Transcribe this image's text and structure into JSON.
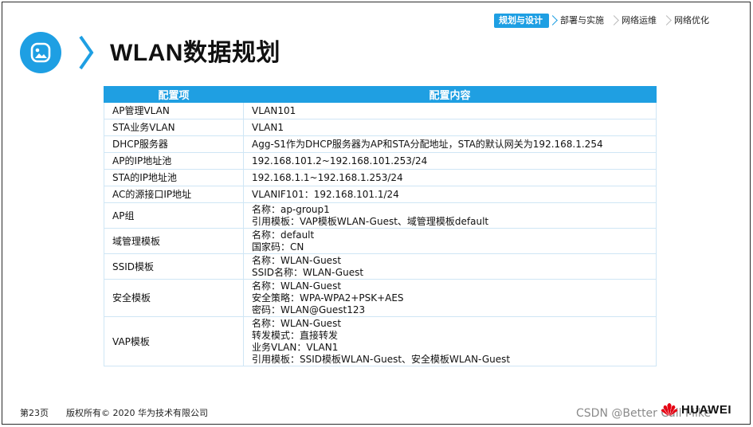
{
  "breadcrumb": {
    "items": [
      "规划与设计",
      "部署与实施",
      "网络运维",
      "网络优化"
    ],
    "active_index": 0
  },
  "header": {
    "title": "WLAN数据规划",
    "logo_icon": "image-icon"
  },
  "table": {
    "headers": [
      "配置项",
      "配置内容"
    ],
    "rows": [
      {
        "key": "AP管理VLAN",
        "lines": [
          "VLAN101"
        ]
      },
      {
        "key": "STA业务VLAN",
        "lines": [
          "VLAN1"
        ]
      },
      {
        "key": "DHCP服务器",
        "lines": [
          "Agg-S1作为DHCP服务器为AP和STA分配地址，STA的默认网关为192.168.1.254"
        ]
      },
      {
        "key": "AP的IP地址池",
        "lines": [
          "192.168.101.2~192.168.101.253/24"
        ]
      },
      {
        "key": "STA的IP地址池",
        "lines": [
          "192.168.1.1~192.168.1.253/24"
        ]
      },
      {
        "key": "AC的源接口IP地址",
        "lines": [
          "VLANIF101：192.168.101.1/24"
        ]
      },
      {
        "key": "AP组",
        "lines": [
          "名称：ap-group1",
          "引用模板：VAP模板WLAN-Guest、域管理模板default"
        ]
      },
      {
        "key": "域管理模板",
        "lines": [
          "名称：default",
          "国家码：CN"
        ]
      },
      {
        "key": "SSID模板",
        "lines": [
          "名称：WLAN-Guest",
          "SSID名称：WLAN-Guest"
        ]
      },
      {
        "key": "安全模板",
        "lines": [
          "名称：WLAN-Guest",
          "安全策略：WPA-WPA2+PSK+AES",
          "密码：WLAN@Guest123"
        ]
      },
      {
        "key": "VAP模板",
        "lines": [
          "名称：WLAN-Guest",
          "转发模式：直接转发",
          "业务VLAN：VLAN1",
          "引用模板：SSID模板WLAN-Guest、安全模板WLAN-Guest"
        ]
      }
    ]
  },
  "footer": {
    "page": "第23页",
    "copyright": "版权所有© 2020 华为技术有限公司",
    "watermark": "CSDN @Better Call Mike",
    "brand": "HUAWEI"
  },
  "colors": {
    "accent": "#1e9fe3",
    "huawei_red": "#e60012"
  }
}
